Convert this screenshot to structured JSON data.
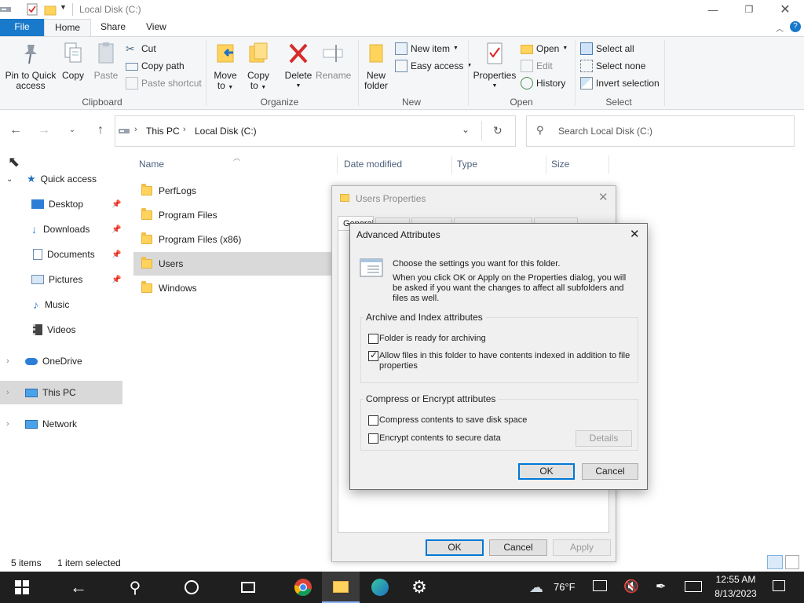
{
  "window": {
    "title": "Local Disk (C:)",
    "controls": [
      "minimize",
      "maximize",
      "close"
    ]
  },
  "ribbon": {
    "tabs": [
      "File",
      "Home",
      "Share",
      "View"
    ],
    "clipboard": {
      "pin_label_1": "Pin to Quick",
      "pin_label_2": "access",
      "copy": "Copy",
      "paste": "Paste",
      "cut": "Cut",
      "copy_path": "Copy path",
      "paste_shortcut": "Paste shortcut",
      "group": "Clipboard"
    },
    "organize": {
      "move_1": "Move",
      "move_2": "to",
      "copyto_1": "Copy",
      "copyto_2": "to",
      "delete": "Delete",
      "rename": "Rename",
      "group": "Organize"
    },
    "new": {
      "folder_1": "New",
      "folder_2": "folder",
      "new_item": "New item",
      "easy_access": "Easy access",
      "group": "New"
    },
    "open": {
      "properties": "Properties",
      "open": "Open",
      "edit": "Edit",
      "history": "History",
      "group": "Open"
    },
    "select": {
      "select_all": "Select all",
      "select_none": "Select none",
      "invert": "Invert selection",
      "group": "Select"
    }
  },
  "nav": {
    "path": [
      "This PC",
      "Local Disk (C:)"
    ],
    "search_placeholder": "Search Local Disk (C:)"
  },
  "sidebar": {
    "items": [
      {
        "label": "Quick access",
        "icon": "star-icon"
      },
      {
        "label": "Desktop",
        "icon": "desktop-icon"
      },
      {
        "label": "Downloads",
        "icon": "download-icon"
      },
      {
        "label": "Documents",
        "icon": "documents-icon"
      },
      {
        "label": "Pictures",
        "icon": "pictures-icon"
      },
      {
        "label": "Music",
        "icon": "music-icon"
      },
      {
        "label": "Videos",
        "icon": "videos-icon"
      },
      {
        "label": "OneDrive",
        "icon": "cloud-icon"
      },
      {
        "label": "This PC",
        "icon": "computer-icon"
      },
      {
        "label": "Network",
        "icon": "network-icon"
      }
    ]
  },
  "filelist": {
    "columns": [
      "Name",
      "Date modified",
      "Type",
      "Size"
    ],
    "rows": [
      {
        "name": "PerfLogs"
      },
      {
        "name": "Program Files"
      },
      {
        "name": "Program Files (x86)"
      },
      {
        "name": "Users"
      },
      {
        "name": "Windows"
      }
    ]
  },
  "status": {
    "count": "5 items",
    "selected": "1 item selected"
  },
  "properties_dialog": {
    "title": "Users Properties",
    "tab_visible": "General",
    "ok": "OK",
    "cancel": "Cancel",
    "apply": "Apply"
  },
  "advanced_dialog": {
    "title": "Advanced Attributes",
    "intro_1": "Choose the settings you want for this folder.",
    "intro_2": "When you click OK or Apply on the Properties dialog, you will be asked if you want the changes to affect all subfolders and files as well.",
    "archive_group": "Archive and Index attributes",
    "archive_cb": "Folder is ready for archiving",
    "index_cb": "Allow files in this folder to have contents indexed in addition to file properties",
    "compress_group": "Compress or Encrypt attributes",
    "compress_cb": "Compress contents to save disk space",
    "encrypt_cb": "Encrypt contents to secure data",
    "details": "Details",
    "ok": "OK",
    "cancel": "Cancel",
    "state": {
      "archive": false,
      "index": true,
      "compress": false,
      "encrypt": false
    }
  },
  "taskbar": {
    "weather": "76°F",
    "time": "12:55 AM",
    "date": "8/13/2023"
  },
  "colors": {
    "accent": "#0078d7",
    "file_tab": "#1979ca",
    "taskbar": "#1f1f1f",
    "selection": "#d9d9d9"
  }
}
